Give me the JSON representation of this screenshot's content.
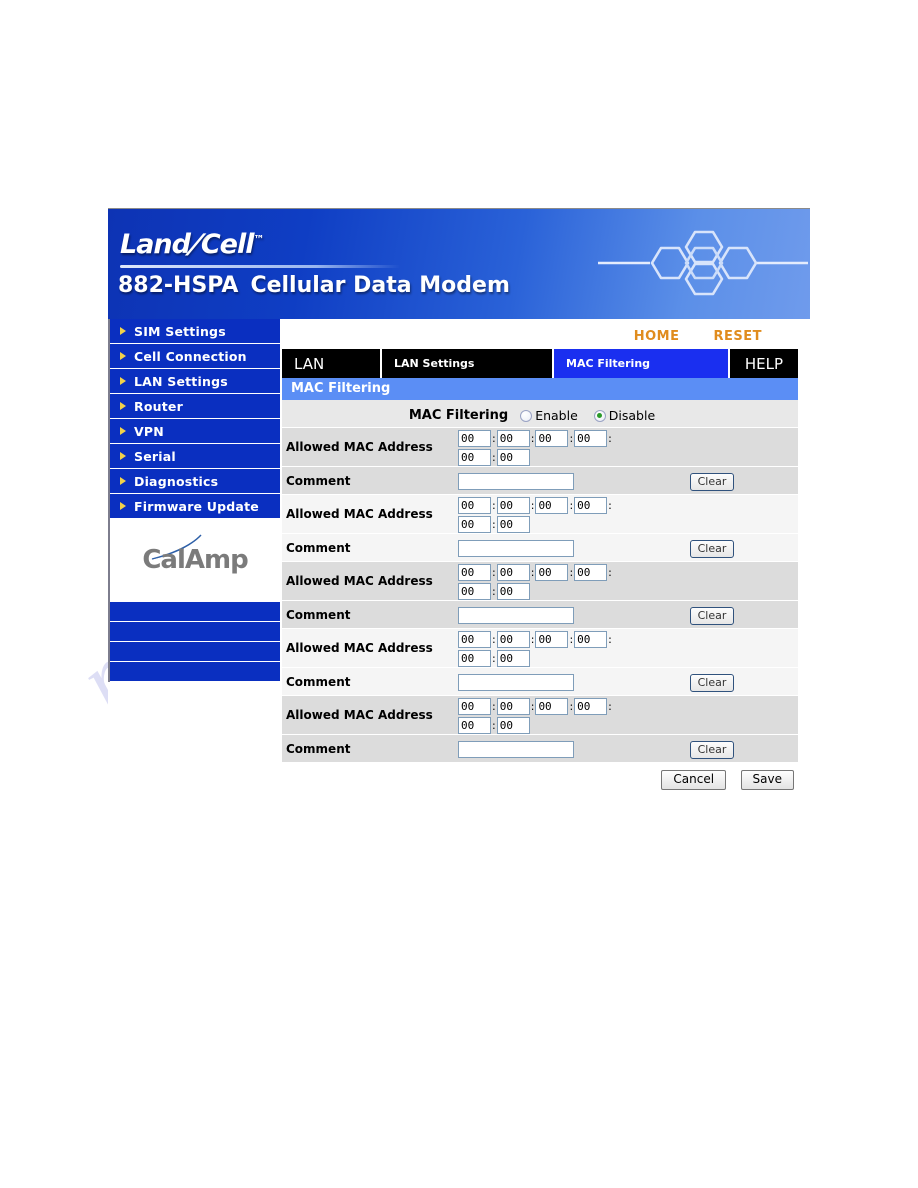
{
  "watermark": {
    "text": "manualshive.com"
  },
  "banner": {
    "brand_part1": "Land",
    "brand_slash": "/",
    "brand_part2": "Cell",
    "brand_tm": "™",
    "model": "882-HSPA",
    "product": "Cellular Data Modem",
    "logo_icon": "hexagon-cluster-icon",
    "gradient_start": "#0d33b4",
    "gradient_end": "#6f9bec"
  },
  "sidebar": {
    "items": [
      {
        "label": "SIM Settings"
      },
      {
        "label": "Cell Connection"
      },
      {
        "label": "LAN Settings"
      },
      {
        "label": "Router"
      },
      {
        "label": "VPN"
      },
      {
        "label": "Serial"
      },
      {
        "label": "Diagnostics"
      },
      {
        "label": "Firmware Update"
      }
    ],
    "logo": {
      "text": "CalAmp",
      "color": "#7b7b7b",
      "swoosh_color": "#2d5fa8"
    },
    "blank_bar_count": 4,
    "background": "#0a2fc0"
  },
  "toplinks": {
    "home": "HOME",
    "reset": "RESET",
    "color": "#e08c1e"
  },
  "tabs": [
    {
      "label": "LAN",
      "active": false
    },
    {
      "label": "LAN Settings",
      "active": false
    },
    {
      "label": "MAC Filtering",
      "active": true
    },
    {
      "label": "HELP",
      "active": false
    }
  ],
  "section": {
    "title": "MAC Filtering",
    "bar_color": "#5b8ef5"
  },
  "mode": {
    "label": "MAC Filtering",
    "options": [
      {
        "label": "Enable",
        "selected": false
      },
      {
        "label": "Disable",
        "selected": true
      }
    ],
    "selected_value": "Disable"
  },
  "form": {
    "mac_label": "Allowed MAC Address",
    "comment_label": "Comment",
    "clear_label": "Clear",
    "octet_value": "00",
    "octet_separator": ":",
    "comment_value": "",
    "comment_placeholder": "",
    "entries": [
      {
        "octets": [
          "00",
          "00",
          "00",
          "00",
          "00",
          "00"
        ],
        "comment": ""
      },
      {
        "octets": [
          "00",
          "00",
          "00",
          "00",
          "00",
          "00"
        ],
        "comment": ""
      },
      {
        "octets": [
          "00",
          "00",
          "00",
          "00",
          "00",
          "00"
        ],
        "comment": ""
      },
      {
        "octets": [
          "00",
          "00",
          "00",
          "00",
          "00",
          "00"
        ],
        "comment": ""
      },
      {
        "octets": [
          "00",
          "00",
          "00",
          "00",
          "00",
          "00"
        ],
        "comment": ""
      }
    ]
  },
  "actions": {
    "cancel": "Cancel",
    "save": "Save"
  }
}
